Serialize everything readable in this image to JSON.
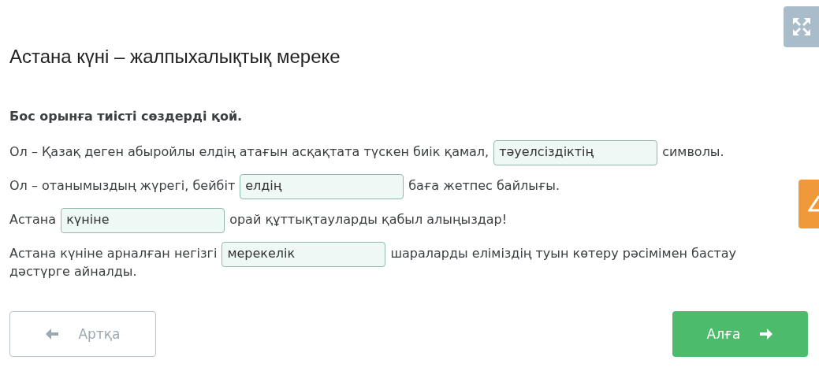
{
  "title": "Астана күні – жалпыхалықтық мереке",
  "instruction": "Бос орынға тиісті сөздерді қой.",
  "sentences": [
    {
      "parts": [
        {
          "kind": "text",
          "text": "Ол – Қазақ деген абыройлы елдің атағын асқақтата түскен биік қамал,"
        },
        {
          "kind": "blank",
          "value": "тәуелсіздіктің"
        },
        {
          "kind": "text",
          "text": "символы."
        }
      ]
    },
    {
      "parts": [
        {
          "kind": "text",
          "text": "Ол – отанымыздың жүрегі, бейбіт"
        },
        {
          "kind": "blank",
          "value": "елдің"
        },
        {
          "kind": "text",
          "text": "баға жетпес байлығы."
        }
      ]
    },
    {
      "parts": [
        {
          "kind": "text",
          "text": "Астана"
        },
        {
          "kind": "blank",
          "value": "күніне"
        },
        {
          "kind": "text",
          "text": "орай құттықтауларды қабыл алыңыздар!"
        }
      ]
    },
    {
      "parts": [
        {
          "kind": "text",
          "text": "Астана күніне арналған негізгі"
        },
        {
          "kind": "blank",
          "value": "мерекелік"
        },
        {
          "kind": "text",
          "text": "шараларды еліміздің туын көтеру рәсімімен бастау"
        },
        {
          "kind": "continuation",
          "text": "дәстүрге айналды."
        }
      ]
    }
  ],
  "buttons": [
    {
      "kind": "back",
      "label": "Артқа"
    },
    {
      "kind": "next",
      "label": "Алға"
    }
  ]
}
